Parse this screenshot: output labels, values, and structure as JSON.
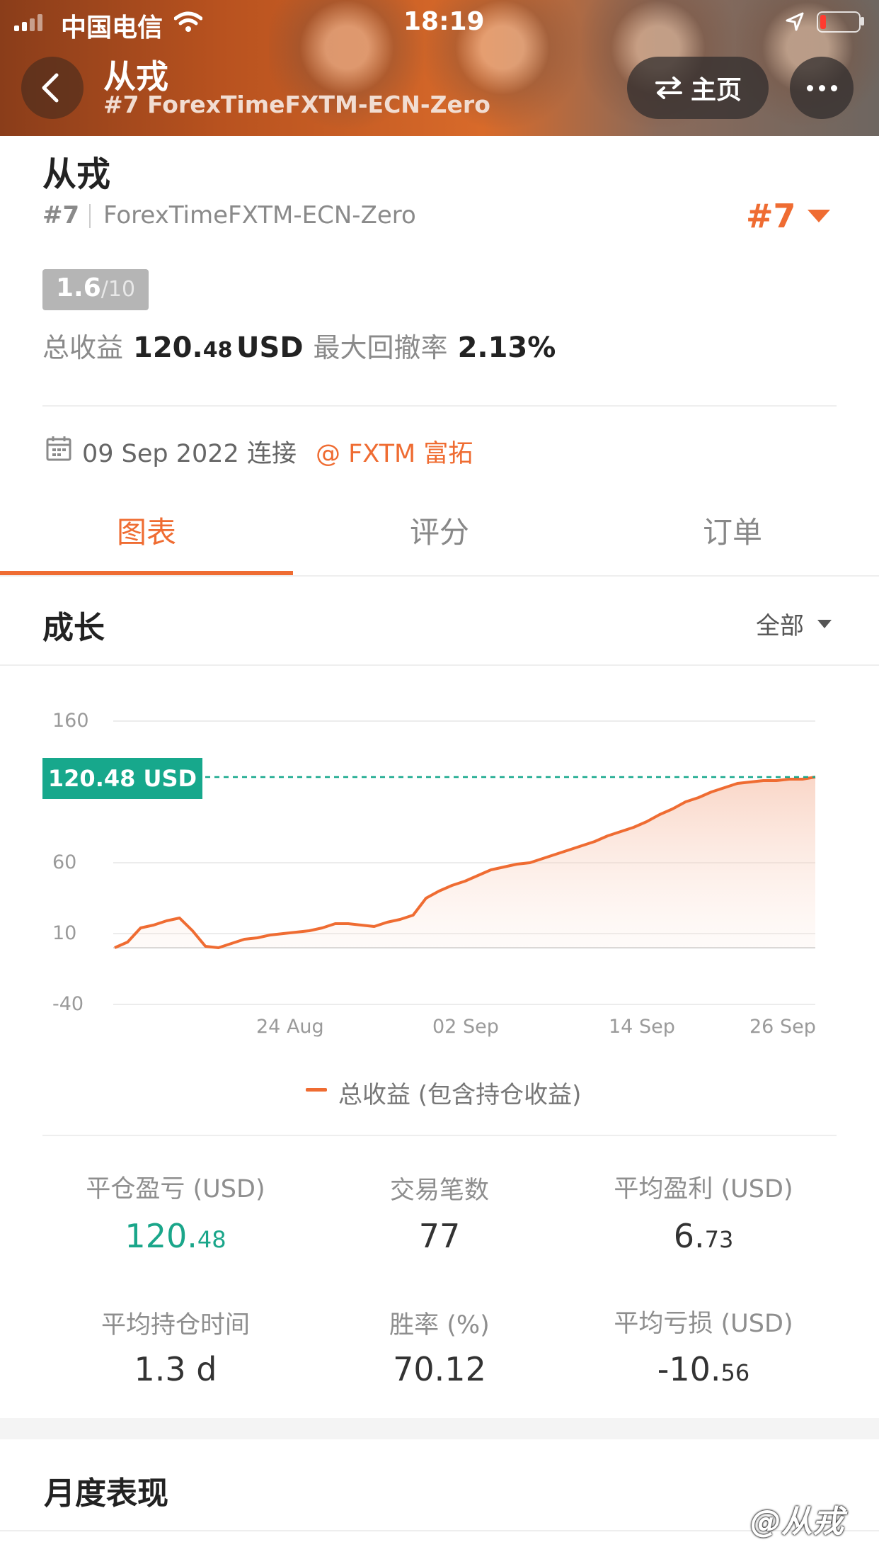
{
  "status_bar": {
    "carrier": "中国电信",
    "time": "18:19"
  },
  "header": {
    "title": "从戎",
    "subtitle": "#7 ForexTimeFXTM-ECN-Zero",
    "home_label": "主页"
  },
  "profile": {
    "name": "从戎",
    "rank": "#7",
    "account": "ForexTimeFXTM-ECN-Zero",
    "rank_selector": "#7",
    "score": "1.6",
    "score_max": "/10",
    "total_profit_label": "总收益",
    "total_profit_int": "120.",
    "total_profit_dec": "48",
    "total_profit_unit": "USD",
    "max_drawdown_label": "最大回撤率",
    "max_drawdown": "2.13%",
    "connect_date": "09 Sep 2022 连接",
    "broker": "@ FXTM 富拓"
  },
  "tabs": [
    {
      "label": "图表",
      "active": true
    },
    {
      "label": "评分",
      "active": false
    },
    {
      "label": "订单",
      "active": false
    }
  ],
  "growth": {
    "title": "成长",
    "filter": "全部"
  },
  "chart_data": {
    "type": "area",
    "yticks": [
      "160",
      "60",
      "10",
      "-40"
    ],
    "ylim": [
      -40,
      160
    ],
    "xticks": [
      "24 Aug",
      "02 Sep",
      "14 Sep",
      "26 Sep"
    ],
    "current_value_label": "120.48 USD",
    "current_value": 120.48,
    "legend": "总收益 (包含持仓收益)",
    "series": [
      {
        "name": "总收益 (包含持仓收益)",
        "values": [
          0,
          4,
          14,
          16,
          19,
          21,
          12,
          1,
          0,
          3,
          6,
          7,
          9,
          10,
          11,
          12,
          14,
          17,
          17,
          16,
          15,
          18,
          20,
          23,
          35,
          40,
          44,
          47,
          51,
          55,
          57,
          59,
          60,
          63,
          66,
          69,
          72,
          75,
          79,
          82,
          85,
          89,
          94,
          98,
          103,
          106,
          110,
          113,
          116,
          117,
          118,
          118,
          119,
          119,
          120.48
        ]
      }
    ],
    "colors": {
      "line": "#ef6c32",
      "value_tag": "#17a88c",
      "reference_line": "#17a88c"
    }
  },
  "stats": [
    {
      "label": "平仓盈亏 (USD)",
      "int": "120.",
      "dec": "48",
      "color": "#1aa68a"
    },
    {
      "label": "交易笔数",
      "int": "77",
      "dec": "",
      "color": "#333333"
    },
    {
      "label": "平均盈利 (USD)",
      "int": "6.",
      "dec": "73",
      "color": "#333333"
    },
    {
      "label": "平均持仓时间",
      "int": "1.3 d",
      "dec": "",
      "color": "#333333"
    },
    {
      "label": "胜率 (%)",
      "int": "70.12",
      "dec": "",
      "color": "#333333"
    },
    {
      "label": "平均亏损 (USD)",
      "int": "-10.",
      "dec": "56",
      "color": "#333333"
    }
  ],
  "monthly": {
    "title": "月度表现"
  },
  "watermark": "@从戎"
}
